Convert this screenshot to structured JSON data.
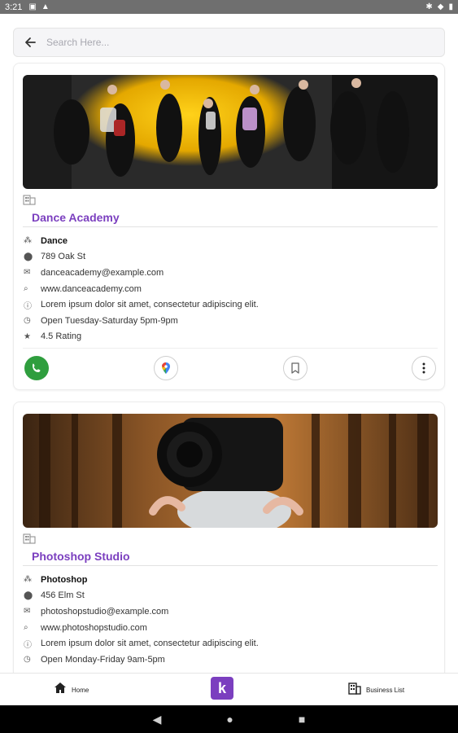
{
  "status_bar": {
    "time": "3:21",
    "left_icons": [
      "image-icon",
      "warning-icon"
    ],
    "right_icons": [
      "bluetooth-icon",
      "wifi-icon",
      "battery-icon"
    ]
  },
  "search": {
    "placeholder": "Search Here...",
    "value": ""
  },
  "listings": [
    {
      "name": "Dance Academy",
      "category": "Dance",
      "address": "789 Oak St",
      "email": "danceacademy@example.com",
      "website": "www.danceacademy.com",
      "description": "Lorem ipsum dolor sit amet, consectetur adipiscing elit.",
      "hours": "Open Tuesday-Saturday 5pm-9pm",
      "rating": "4.5 Rating"
    },
    {
      "name": "Photoshop Studio",
      "category": "Photoshop",
      "address": "456 Elm St",
      "email": "photoshopstudio@example.com",
      "website": "www.photoshopstudio.com",
      "description": "Lorem ipsum dolor sit amet, consectetur adipiscing elit.",
      "hours": "Open Monday-Friday 9am-5pm"
    }
  ],
  "bottom_nav": {
    "home_label": "Home",
    "center_label": "k",
    "list_label": "Business List"
  },
  "colors": {
    "accent": "#7b3fbf",
    "call_green": "#2f9e3e",
    "status_bar": "#6f6f6f"
  }
}
